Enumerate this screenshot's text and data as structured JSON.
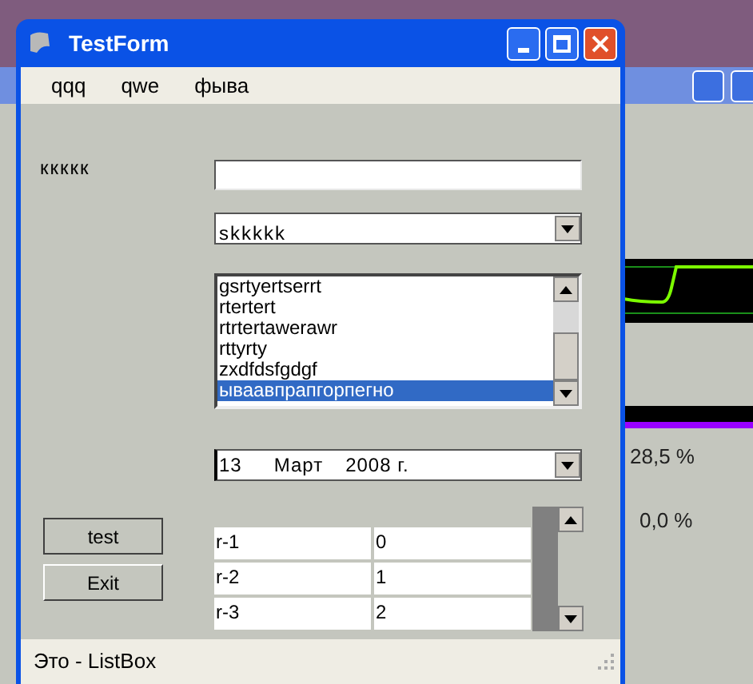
{
  "window": {
    "title": "TestForm"
  },
  "menu": [
    {
      "label": "qqq"
    },
    {
      "label": "qwe"
    },
    {
      "label": "фыва"
    }
  ],
  "label": "ккккк",
  "combo": {
    "value": "skkkkk"
  },
  "listbox": {
    "items": [
      {
        "label": "gsrtyertserrt",
        "selected": false
      },
      {
        "label": "rtertert",
        "selected": false
      },
      {
        "label": "rtrtertawerawr",
        "selected": false
      },
      {
        "label": "rttyrty",
        "selected": false
      },
      {
        "label": "zxdfdsfgdgf",
        "selected": false
      },
      {
        "label": "ываавпрапгорпегно",
        "selected": true
      }
    ]
  },
  "date": {
    "day": "13",
    "month": "Март",
    "year": "2008 г."
  },
  "grid": {
    "rows": [
      [
        "r-1",
        "0"
      ],
      [
        "r-2",
        "1"
      ],
      [
        "r-3",
        "2"
      ]
    ]
  },
  "buttons": [
    {
      "label": "test"
    },
    {
      "label": "Exit"
    }
  ],
  "status_bar": "Это - ListBox",
  "background_window": {
    "readings": [
      "28,5 %",
      "0,0 %"
    ]
  }
}
